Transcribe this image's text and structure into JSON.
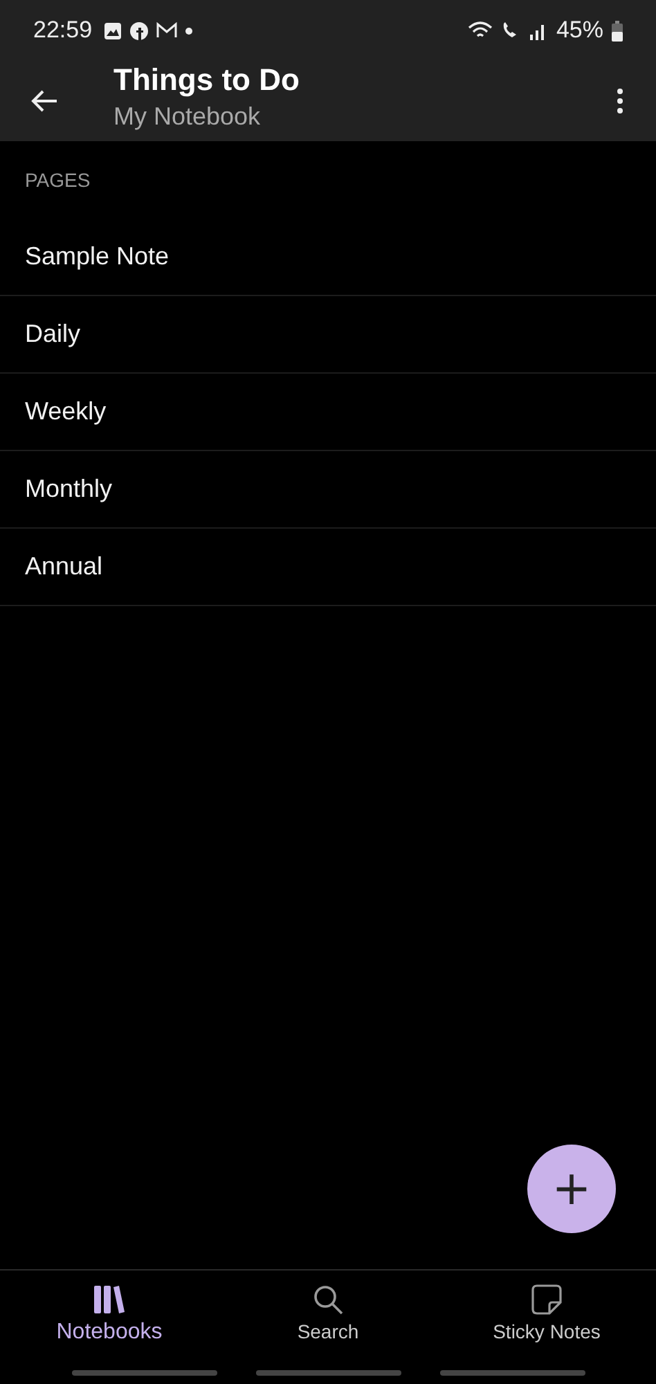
{
  "status_bar": {
    "time": "22:59",
    "battery": "45%"
  },
  "header": {
    "title": "Things to Do",
    "subtitle": "My Notebook"
  },
  "section_label": "PAGES",
  "pages": [
    {
      "title": "Sample Note"
    },
    {
      "title": "Daily"
    },
    {
      "title": "Weekly"
    },
    {
      "title": "Monthly"
    },
    {
      "title": "Annual"
    }
  ],
  "fab": {
    "symbol": "+"
  },
  "bottom_nav": [
    {
      "kind": "notebooks",
      "label": "Notebooks",
      "selected": true
    },
    {
      "kind": "search",
      "label": "Search",
      "selected": false
    },
    {
      "kind": "sticky",
      "label": "Sticky Notes",
      "selected": false
    }
  ]
}
